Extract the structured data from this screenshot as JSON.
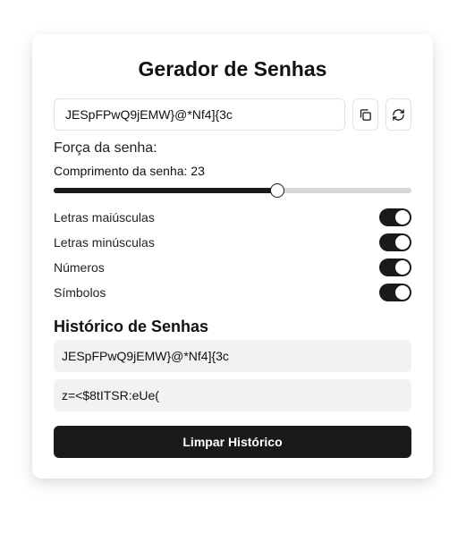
{
  "title": "Gerador de Senhas",
  "password": "JESpFPwQ9jEMW}@*Nf4]{3c",
  "icons": {
    "copy": "copy-icon",
    "refresh": "refresh-icon"
  },
  "strength_label": "Força da senha:",
  "length_label": "Comprimento da senha: 23",
  "length_value": 23,
  "slider": {
    "min": 8,
    "max": 32,
    "value": 23
  },
  "options": [
    {
      "label": "Letras maiúsculas",
      "checked": true
    },
    {
      "label": "Letras minúsculas",
      "checked": true
    },
    {
      "label": "Números",
      "checked": true
    },
    {
      "label": "Símbolos",
      "checked": true
    }
  ],
  "history": {
    "title": "Histórico de Senhas",
    "items": [
      "JESpFPwQ9jEMW}@*Nf4]{3c",
      "z=<$8tITSR:eUe("
    ]
  },
  "clear_button": "Limpar Histórico",
  "colors": {
    "accent": "#1a1a1a",
    "track": "#d6d6d6",
    "history_bg": "#f1f2f4"
  }
}
